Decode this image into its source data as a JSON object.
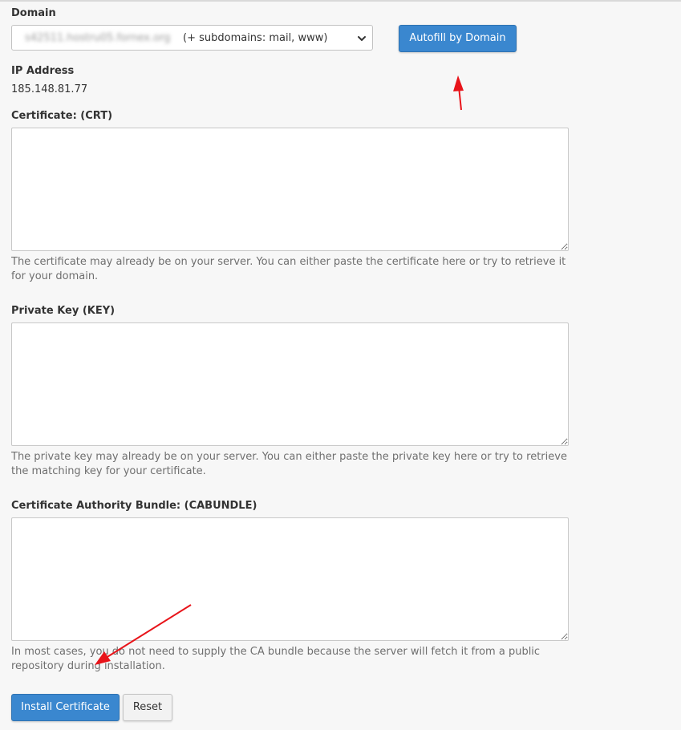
{
  "domain": {
    "label": "Domain",
    "selected_value": "s42511.hostru05.fornex.org",
    "selected_suffix": "(+ subdomains: mail, www)"
  },
  "autofill_button_label": "Autofill by Domain",
  "ip": {
    "label": "IP Address",
    "value": "185.148.81.77"
  },
  "certificate": {
    "label": "Certificate: (CRT)",
    "value": "",
    "help": "The certificate may already be on your server. You can either paste the certificate here or try to retrieve it for your domain."
  },
  "private_key": {
    "label": "Private Key (KEY)",
    "value": "",
    "help": "The private key may already be on your server. You can either paste the private key here or try to retrieve the matching key for your certificate."
  },
  "cabundle": {
    "label": "Certificate Authority Bundle: (CABUNDLE)",
    "value": "",
    "help": "In most cases, you do not need to supply the CA bundle because the server will fetch it from a public repository during installation."
  },
  "buttons": {
    "install": "Install Certificate",
    "reset": "Reset"
  },
  "colors": {
    "primary": "#3a87cf",
    "annotation_arrow": "#e8141a"
  }
}
